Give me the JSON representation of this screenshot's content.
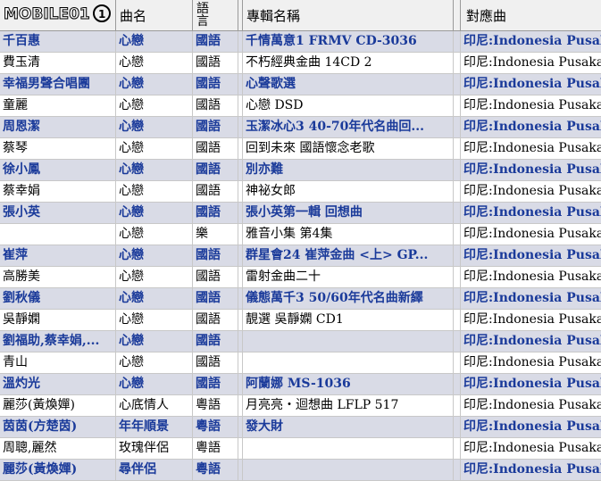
{
  "header": {
    "singer_logo": "MOBILE01",
    "song": "曲名",
    "lang_top": "語",
    "lang_bottom": "言",
    "album": "專輯名稱",
    "match": "對應曲"
  },
  "rows": [
    {
      "singer": "千百惠",
      "song": "心戀",
      "lang": "國語",
      "album": "千情萬意1 FRMV CD-3036",
      "match": "印尼:Indonesia Pusaka"
    },
    {
      "singer": "費玉清",
      "song": "心戀",
      "lang": "國語",
      "album": "不朽經典金曲 14CD 2",
      "match": "印尼:Indonesia Pusaka"
    },
    {
      "singer": "幸福男聲合唱團",
      "song": "心戀",
      "lang": "國語",
      "album": "心聲歌選",
      "match": "印尼:Indonesia Pusaka"
    },
    {
      "singer": "童麗",
      "song": "心戀",
      "lang": "國語",
      "album": "心戀 DSD",
      "match": "印尼:Indonesia Pusaka"
    },
    {
      "singer": "周恩潔",
      "song": "心戀",
      "lang": "國語",
      "album": "玉潔冰心3 40-70年代名曲回...",
      "match": "印尼:Indonesia Pusaka"
    },
    {
      "singer": "蔡琴",
      "song": "心戀",
      "lang": "國語",
      "album": "回到未來 國語懷念老歌",
      "match": "印尼:Indonesia Pusaka"
    },
    {
      "singer": "徐小鳳",
      "song": "心戀",
      "lang": "國語",
      "album": "別亦難",
      "match": "印尼:Indonesia Pusaka"
    },
    {
      "singer": "蔡幸娟",
      "song": "心戀",
      "lang": "國語",
      "album": "神祕女郎",
      "match": "印尼:Indonesia Pusaka"
    },
    {
      "singer": "張小英",
      "song": "心戀",
      "lang": "國語",
      "album": "張小英第一輯 回想曲",
      "match": "印尼:Indonesia Pusaka"
    },
    {
      "singer": "",
      "song": "心戀",
      "lang": "樂",
      "album": "雅音小集 第4集",
      "match": "印尼:Indonesia Pusaka"
    },
    {
      "singer": "崔萍",
      "song": "心戀",
      "lang": "國語",
      "album": "群星會24 崔萍金曲 <上> GP...",
      "match": "印尼:Indonesia Pusaka"
    },
    {
      "singer": "高勝美",
      "song": "心戀",
      "lang": "國語",
      "album": "雷射金曲二十",
      "match": "印尼:Indonesia Pusaka"
    },
    {
      "singer": "劉秋儀",
      "song": "心戀",
      "lang": "國語",
      "album": "儀態萬千3 50/60年代名曲新繹",
      "match": "印尼:Indonesia Pusaka"
    },
    {
      "singer": "吳靜嫻",
      "song": "心戀",
      "lang": "國語",
      "album": "靚選 吳靜嫻 CD1",
      "match": "印尼:Indonesia Pusaka"
    },
    {
      "singer": "劉福助,蔡幸娟,...",
      "song": "心戀",
      "lang": "國語",
      "album": "",
      "match": "印尼:Indonesia Pusaka"
    },
    {
      "singer": "青山",
      "song": "心戀",
      "lang": "國語",
      "album": "",
      "match": "印尼:Indonesia Pusaka"
    },
    {
      "singer": "溫灼光",
      "song": "心戀",
      "lang": "國語",
      "album": "阿蘭娜 MS-1036",
      "match": "印尼:Indonesia Pusaka"
    },
    {
      "singer": "麗莎(黃煥嬋)",
      "song": "心底情人",
      "lang": "粵語",
      "album": "月亮亮・迴想曲 LFLP 517",
      "match": "印尼:Indonesia Pusaka"
    },
    {
      "singer": "茵茵(方楚茵)",
      "song": "年年順景",
      "lang": "粵語",
      "album": "發大財",
      "match": "印尼:Indonesia Pusaka"
    },
    {
      "singer": "周聰,麗然",
      "song": "玫瑰伴侶",
      "lang": "粵語",
      "album": "",
      "match": "印尼:Indonesia Pusaka"
    },
    {
      "singer": "麗莎(黃煥嬋)",
      "song": "尋伴侶",
      "lang": "粵語",
      "album": "",
      "match": "印尼:Indonesia Pusaka"
    }
  ]
}
